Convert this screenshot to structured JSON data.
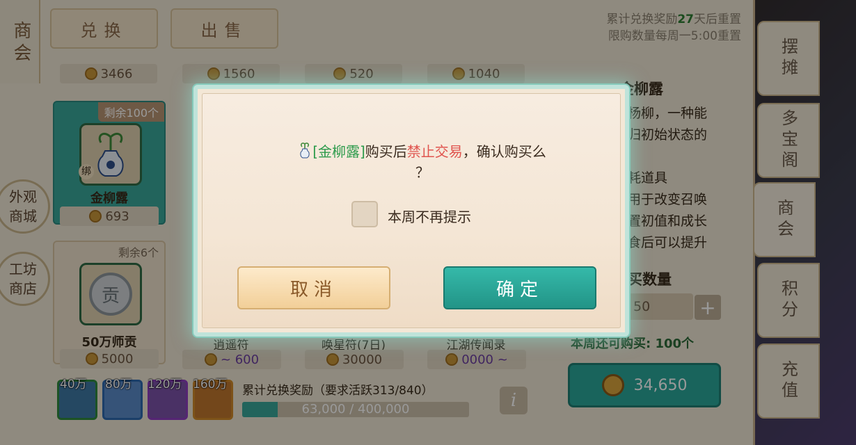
{
  "colors": {
    "accent_teal": "#2aa79a",
    "warning_red": "#e0554f",
    "item_link_green": "#2b9a4a",
    "panel_bg": "#efe6d4"
  },
  "left_nav": {
    "commerce_label": "商会",
    "appearance_mall_label": "外观商城",
    "workshop_store_label": "工坊商店"
  },
  "top_tabs": {
    "exchange": "兑换",
    "sell": "出售"
  },
  "reset_info": {
    "line1_prefix": "累计兑换奖励",
    "line1_days": "27",
    "line1_suffix": "天后重置",
    "line2": "限购数量每周一5:00重置"
  },
  "top_prices": [
    "3466",
    "1560",
    "520",
    "1040"
  ],
  "items": [
    {
      "remaining": "剩余100个",
      "bind": "绑",
      "name": "金柳露",
      "price": "693",
      "icon": "vase-icon"
    },
    {
      "remaining": "剩余6个",
      "name": "50万师贡",
      "price": "5000",
      "icon": "coin-badge-icon",
      "glyph": "贡"
    }
  ],
  "partial_items": [
    {
      "name_fragment": "逍遥符",
      "price": "~ 600"
    },
    {
      "name_fragment": "唤星符(7日)",
      "price": "30000"
    },
    {
      "name_fragment": "江湖传闻录",
      "price": "0000 ~"
    }
  ],
  "right_tabs": [
    "摆摊",
    "多宝阁",
    "商会",
    "积分",
    "充值"
  ],
  "detail": {
    "title": "金柳露",
    "lines": [
      "杨柳，一种能",
      "归初始状态的",
      "",
      "耗道具",
      "用于改变召唤",
      "置初值和成长",
      "食后可以提升"
    ],
    "qty_label": "买数量",
    "qty_value": "50",
    "qty_plus": "+",
    "weekly_limit": "本周还可购买: 100个",
    "total_price": "34,650"
  },
  "rewards": {
    "tiers": [
      "40万",
      "80万",
      "120万",
      "160万"
    ],
    "label": "累计兑换奖励（要求活跃313/840）",
    "progress_text": "63,000 / 400,000",
    "progress": 0.1575,
    "info_glyph": "i"
  },
  "dialog": {
    "item_name": "[金柳露]",
    "message_mid": "购买后",
    "message_warn": "禁止交易",
    "message_tail": "，确认购买么",
    "message_end": "？",
    "checkbox_label": "本周不再提示",
    "checkbox_checked": false,
    "cancel_label": "取消",
    "confirm_label": "确定"
  }
}
